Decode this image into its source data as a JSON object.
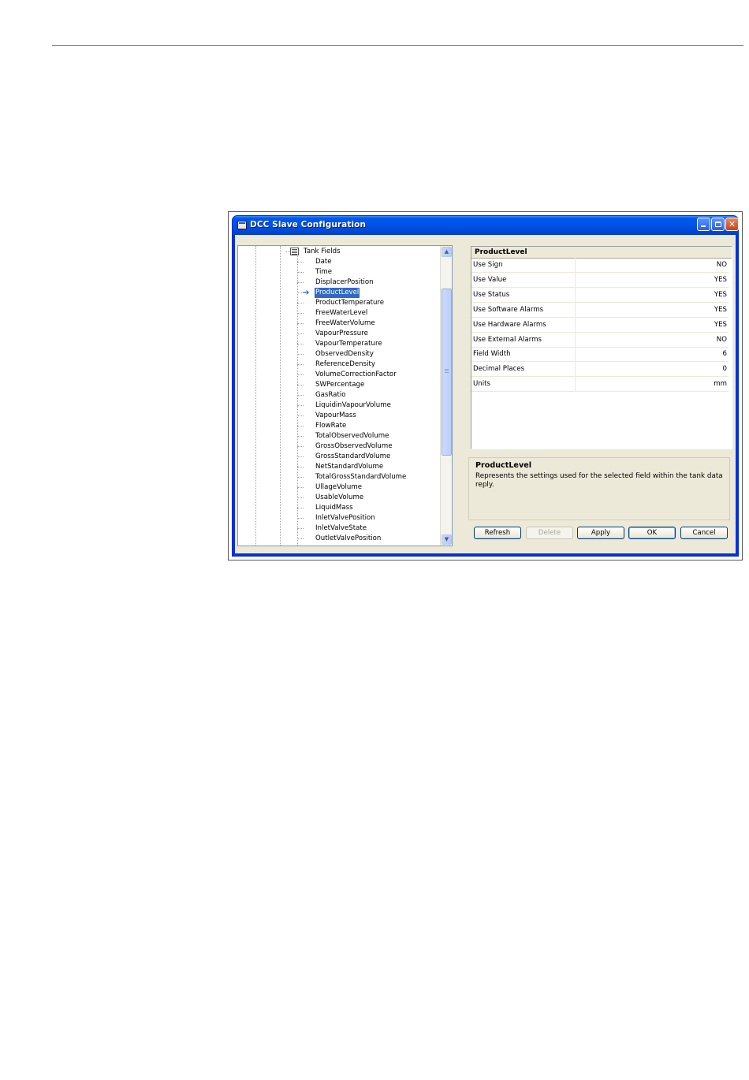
{
  "window": {
    "title": "DCC Slave Configuration"
  },
  "tree": {
    "parent_label": "Tank Fields",
    "items": [
      "Date",
      "Time",
      "DisplacerPosition",
      "ProductLevel",
      "ProductTemperature",
      "FreeWaterLevel",
      "FreeWaterVolume",
      "VapourPressure",
      "VapourTemperature",
      "ObservedDensity",
      "ReferenceDensity",
      "VolumeCorrectionFactor",
      "SWPercentage",
      "GasRatio",
      "LiquidinVapourVolume",
      "VapourMass",
      "FlowRate",
      "TotalObservedVolume",
      "GrossObservedVolume",
      "GrossStandardVolume",
      "NetStandardVolume",
      "TotalGrossStandardVolume",
      "UllageVolume",
      "UsableVolume",
      "LiquidMass",
      "InletValvePosition",
      "InletValveState",
      "OutletValvePosition"
    ],
    "selected": "ProductLevel"
  },
  "properties": {
    "header": "ProductLevel",
    "rows": [
      {
        "name": "Use Sign",
        "value": "NO"
      },
      {
        "name": "Use Value",
        "value": "YES"
      },
      {
        "name": "Use Status",
        "value": "YES"
      },
      {
        "name": "Use Software Alarms",
        "value": "YES"
      },
      {
        "name": "Use Hardware Alarms",
        "value": "YES"
      },
      {
        "name": "Use External Alarms",
        "value": "NO"
      },
      {
        "name": "Field Width",
        "value": "6"
      },
      {
        "name": "Decimal Places",
        "value": "0"
      },
      {
        "name": "Units",
        "value": "mm"
      }
    ]
  },
  "description": {
    "title": "ProductLevel",
    "text": "Represents the settings used for the selected field within the tank data reply."
  },
  "buttons": {
    "refresh": "Refresh",
    "delete": "Delete",
    "apply": "Apply",
    "ok": "OK",
    "cancel": "Cancel"
  },
  "icons": {
    "title": "window-app-icon",
    "tree_node": "table-node-icon",
    "selection_arrow": "arrow-right-icon"
  },
  "colors": {
    "selection": "#316ac5",
    "titlebar": "#0053e6",
    "dialog_face": "#ece9d8"
  }
}
